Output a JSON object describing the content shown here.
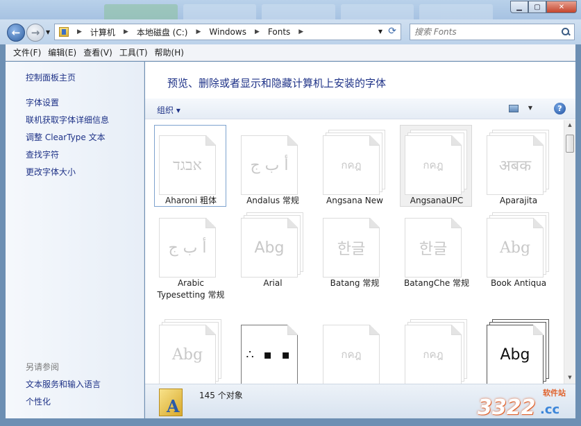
{
  "window": {
    "minimize_glyph": "▁",
    "maximize_glyph": "▢",
    "close_glyph": "✕"
  },
  "nav": {
    "back_icon": "arrow-left",
    "forward_icon": "arrow-right"
  },
  "breadcrumbs": [
    "计算机",
    "本地磁盘 (C:)",
    "Windows",
    "Fonts"
  ],
  "search": {
    "placeholder": "搜索 Fonts"
  },
  "menu": [
    "文件(F)",
    "编辑(E)",
    "查看(V)",
    "工具(T)",
    "帮助(H)"
  ],
  "leftpane": {
    "home": "控制面板主页",
    "links": [
      "字体设置",
      "联机获取字体详细信息",
      "调整 ClearType 文本",
      "查找字符",
      "更改字体大小"
    ],
    "see_also": "另请参阅",
    "see_also_links": [
      "文本服务和输入语言",
      "个性化"
    ]
  },
  "main": {
    "title": "预览、删除或者显示和隐藏计算机上安装的字体",
    "organize": "组织 ▾"
  },
  "fonts": [
    {
      "name": "Aharoni 粗体",
      "sample": "אבגד"
    },
    {
      "name": "Andalus 常规",
      "sample": "أ ب ج"
    },
    {
      "name": "Angsana New",
      "sample": "กคฎ"
    },
    {
      "name": "AngsanaUPC",
      "sample": "กคฎ"
    },
    {
      "name": "Aparajita",
      "sample": "अबक"
    },
    {
      "name": "Arabic Typesetting 常规",
      "sample": "أ ب ج"
    },
    {
      "name": "Arial",
      "sample": "Abg"
    },
    {
      "name": "Batang 常规",
      "sample": "한글"
    },
    {
      "name": "BatangChe 常规",
      "sample": "한글"
    },
    {
      "name": "Book Antiqua",
      "sample": "Abg"
    },
    {
      "name": "",
      "sample": "Abg"
    },
    {
      "name": "",
      "sample": "∴ ▪ ▪"
    },
    {
      "name": "",
      "sample": "กคฎ"
    },
    {
      "name": "",
      "sample": "กคฎ"
    },
    {
      "name": "",
      "sample": "Abg"
    }
  ],
  "status": {
    "count": "145 个对象"
  },
  "watermark": {
    "number": "3322",
    "domain": ".cc",
    "site": "软件站"
  }
}
